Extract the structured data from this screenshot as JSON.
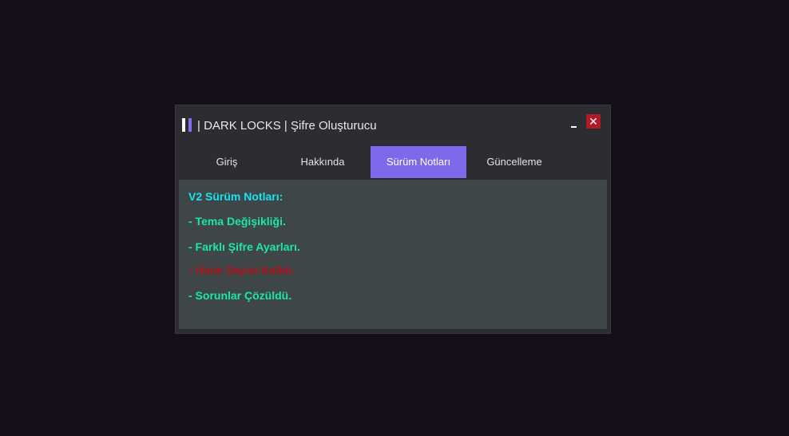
{
  "window": {
    "title": "| DARK LOCKS | Şifre Oluşturucu",
    "close_symbol": "✕",
    "icons": [
      "app-logo-icon",
      "minimize-icon",
      "close-icon"
    ]
  },
  "tabs": [
    {
      "label": "Giriş",
      "active": false
    },
    {
      "label": "Hakkında",
      "active": false
    },
    {
      "label": "Sürüm Notları",
      "active": true
    },
    {
      "label": "Güncelleme",
      "active": false
    }
  ],
  "notes": {
    "heading": "V2 Sürüm Notları:",
    "items": [
      {
        "text": "- Tema Değişikliği.",
        "color": "#1ee6a4"
      },
      {
        "text": "- Farklı Şifre Ayarları.",
        "color": "#1ee6a4"
      },
      {
        "text": "- Hane Sayısı Kalktı.",
        "color": "#b01218"
      },
      {
        "text": "- Sorunlar Çözüldü.",
        "color": "#1ee6a4"
      }
    ]
  },
  "colors": {
    "background": "#140f19",
    "window": "#2c2d31",
    "content": "#3e4647",
    "accent": "#8068ea",
    "heading": "#19e3f2",
    "added": "#1ee6a4",
    "removed": "#b01218",
    "close": "#b01a24"
  }
}
